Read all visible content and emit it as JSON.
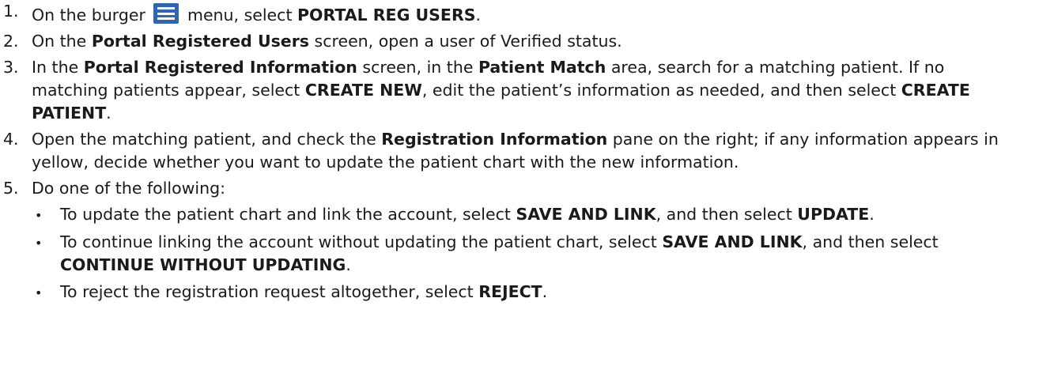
{
  "steps": [
    {
      "num": "1.",
      "parts": {
        "a": "On the burger ",
        "b": " menu, select ",
        "c": "PORTAL REG USERS",
        "d": "."
      },
      "icon": "burger-menu-icon"
    },
    {
      "num": "2.",
      "parts": {
        "a": "On the ",
        "b": "Portal Registered Users",
        "c": " screen, open a user of Verified status."
      }
    },
    {
      "num": "3.",
      "parts": {
        "a": "In the ",
        "b": "Portal Registered Information",
        "c": " screen, in the ",
        "d": "Patient Match",
        "e": " area, search for a matching patient. If no matching patients appear, select ",
        "f": "CREATE NEW",
        "g": ", edit the patient’s information as needed, and then select ",
        "h": "CREATE PATIENT",
        "i": "."
      }
    },
    {
      "num": "4.",
      "parts": {
        "a": "Open the matching patient, and check the ",
        "b": "Registration Information",
        "c": " pane on the right; if any information appears in yellow, decide whether you want to update the patient chart with the new information."
      }
    },
    {
      "num": "5.",
      "parts": {
        "a": "Do one of the following:"
      },
      "bullets": [
        {
          "a": "To update the patient chart and link the account, select ",
          "b": "SAVE AND LINK",
          "c": ", and then select ",
          "d": "UPDATE",
          "e": "."
        },
        {
          "a": "To continue linking the account without updating the patient chart, select ",
          "b": "SAVE AND LINK",
          "c": ", and then select ",
          "d": "CONTINUE WITHOUT UPDATING",
          "e": "."
        },
        {
          "a": "To reject the registration request altogether, select ",
          "b": "REJECT",
          "c": "."
        }
      ]
    }
  ],
  "colors": {
    "burger_icon": "#2d66b8",
    "text": "#1a1a1a"
  }
}
